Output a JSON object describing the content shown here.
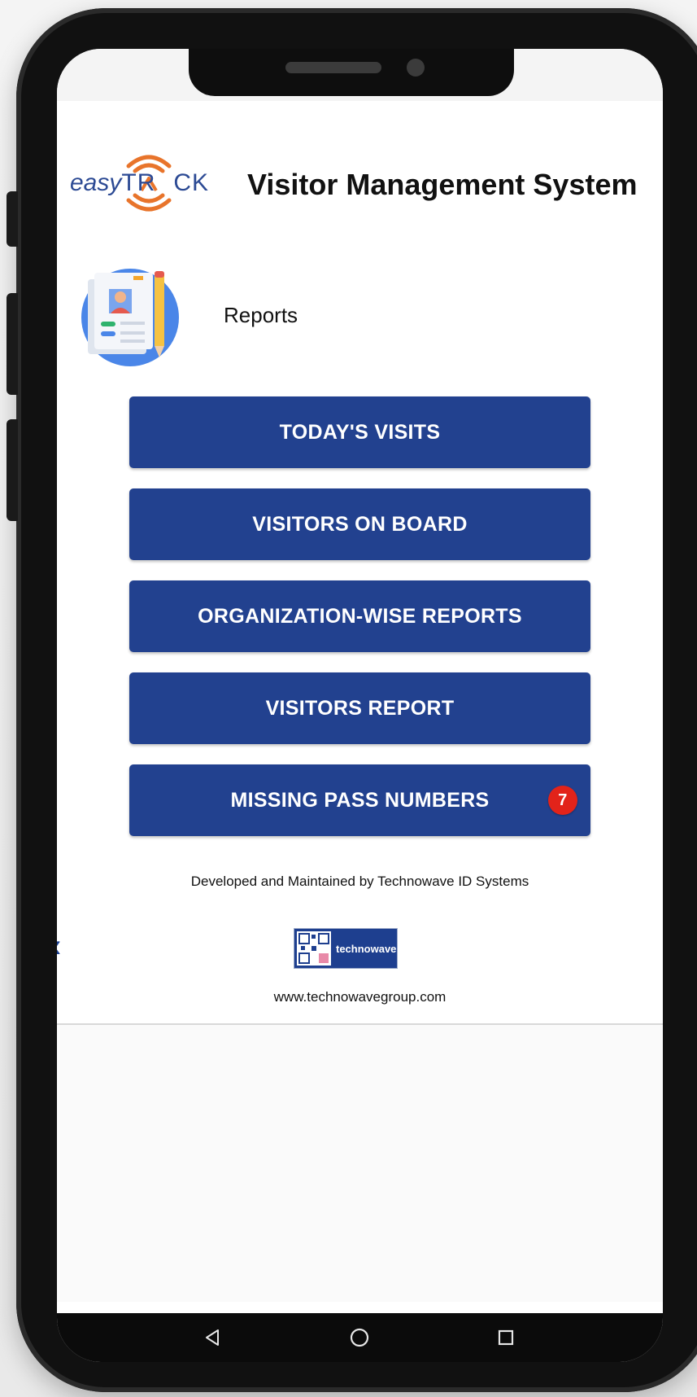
{
  "header": {
    "logo_easy": "easy",
    "logo_track": "TR",
    "logo_track_end": "CK",
    "title": "Visitor Management System"
  },
  "section": {
    "title": "Reports",
    "icon": "report-document-icon"
  },
  "menu": {
    "items": [
      {
        "label": "TODAY'S VISITS"
      },
      {
        "label": "VISITORS ON BOARD"
      },
      {
        "label": "ORGANIZATION-WISE REPORTS"
      },
      {
        "label": "VISITORS REPORT"
      },
      {
        "label": "MISSING PASS NUMBERS",
        "badge": "7"
      }
    ]
  },
  "footer": {
    "developed_by": "Developed and Maintained by Technowave ID Systems",
    "company_logo_text": "technowave",
    "url": "www.technowavegroup.com"
  },
  "colors": {
    "primary_button": "#22418f",
    "badge": "#e2231a",
    "logo_orange": "#e8742b",
    "logo_blue": "#2c4a94"
  },
  "navbar": {
    "back_icon": "triangle-back-icon",
    "home_icon": "circle-home-icon",
    "recents_icon": "square-recents-icon"
  }
}
